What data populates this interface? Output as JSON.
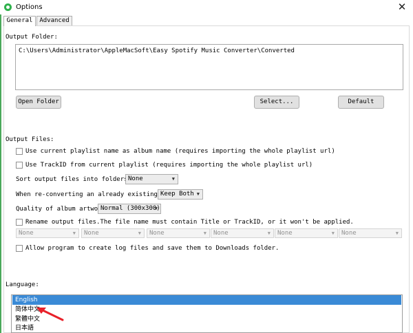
{
  "window": {
    "title": "Options",
    "close_symbol": "✕"
  },
  "tabs": [
    {
      "label": "General"
    },
    {
      "label": "Advanced"
    }
  ],
  "output_folder": {
    "label": "Output Folder:",
    "path": "C:\\Users\\Administrator\\AppleMacSoft\\Easy Spotify Music Converter\\Converted",
    "open_folder_label": "Open Folder",
    "select_label": "Select...",
    "default_label": "Default"
  },
  "output_files": {
    "label": "Output Files:",
    "use_playlist_name_label": "Use current playlist name as album name (requires importing the whole playlist url)",
    "use_trackid_label": "Use TrackID from current playlist (requires importing the whole playlist url)",
    "sort_label": "Sort output files into folders by:",
    "sort_value": "None",
    "reconvert_label": "When re-converting an already existing file:",
    "reconvert_value": "Keep Both",
    "artwork_label": "Quality of album artwork:",
    "artwork_value": "Normal (300x300)",
    "rename_label": "Rename output files.The file name must contain Title or TrackID, or it won't be applied.",
    "rename_fields": [
      "None",
      "None",
      "None",
      "None",
      "None",
      "None"
    ],
    "log_label": "Allow program to create log files and save them to Downloads folder."
  },
  "language": {
    "label": "Language:",
    "options": [
      "English",
      "简体中文",
      "繁體中文",
      "日本語"
    ],
    "selected": "English"
  },
  "colors": {
    "selection": "#3a8ad6",
    "annotation_arrow": "#e8212a",
    "app_icon": "#2fb14c"
  }
}
